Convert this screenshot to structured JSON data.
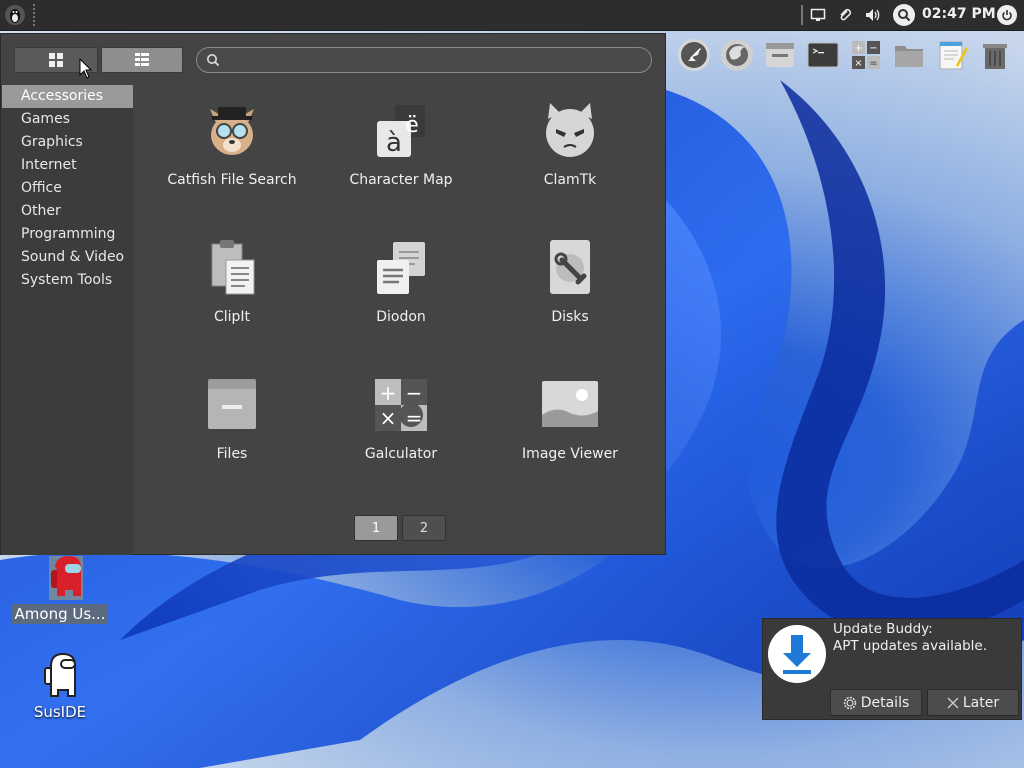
{
  "panel": {
    "clock": "02:47 PM"
  },
  "menu": {
    "search_placeholder": "",
    "categories": [
      {
        "label": "Accessories",
        "active": true
      },
      {
        "label": "Games"
      },
      {
        "label": "Graphics"
      },
      {
        "label": "Internet"
      },
      {
        "label": "Office"
      },
      {
        "label": "Other"
      },
      {
        "label": "Programming"
      },
      {
        "label": "Sound & Video"
      },
      {
        "label": "System Tools"
      }
    ],
    "apps": [
      {
        "label": "Catfish File Search",
        "icon": "catfish-icon"
      },
      {
        "label": "Character Map",
        "icon": "character-map-icon"
      },
      {
        "label": "ClamTk",
        "icon": "clamtk-icon"
      },
      {
        "label": "ClipIt",
        "icon": "clipit-icon"
      },
      {
        "label": "Diodon",
        "icon": "diodon-icon"
      },
      {
        "label": "Disks",
        "icon": "disks-icon"
      },
      {
        "label": "Files",
        "icon": "files-icon"
      },
      {
        "label": "Galculator",
        "icon": "galculator-icon"
      },
      {
        "label": "Image Viewer",
        "icon": "image-viewer-icon"
      }
    ],
    "char_map_glyphs": {
      "back": "ë",
      "front": "à"
    },
    "calc_glyphs": {
      "plus": "+",
      "minus": "−",
      "times": "×",
      "equals": "="
    },
    "pages": [
      "1",
      "2"
    ],
    "current_page": "1"
  },
  "dock": [
    "rocket-icon",
    "firefox-icon",
    "window-icon",
    "terminal-icon",
    "calculator-icon",
    "folder-icon",
    "notepad-icon",
    "trash-icon"
  ],
  "desktop": {
    "icons": [
      {
        "label": "Among Us...",
        "selected": true
      },
      {
        "label": "SusIDE",
        "selected": false
      }
    ]
  },
  "notification": {
    "title": "Update Buddy:",
    "message": "APT updates available.",
    "details_label": "Details",
    "later_label": "Later"
  },
  "colors": {
    "panel_bg": "#2d2d2d",
    "menu_bg": "#444444",
    "category_active": "#9a9a9a",
    "wallpaper_blue": "#1f5be0"
  }
}
